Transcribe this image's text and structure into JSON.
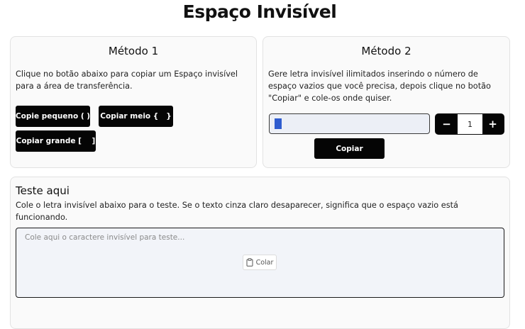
{
  "page": {
    "title": "Espaço Invisível"
  },
  "method1": {
    "title": "Método 1",
    "description": "Clique no botão abaixo para copiar um Espaço invisível para a área de transferência.",
    "buttons": {
      "small": "Copie pequeno ( )",
      "medium": "Copiar meio {   }",
      "large": "Copiar grande [    ]"
    }
  },
  "method2": {
    "title": "Método 2",
    "description": "Gere letra invisível ilimitados inserindo o número de espaço vazios que você precisa, depois clique no botão \"Copiar\" e cole-os onde quiser.",
    "stepper": {
      "minus": "−",
      "value": "1",
      "plus": "+"
    },
    "copy_label": "Copiar"
  },
  "test": {
    "title": "Teste aqui",
    "description": "Cole o letra invisível abaixo para o teste. Se o texto cinza claro desaparecer, significa que o espaço vazio está funcionando.",
    "placeholder": "Cole aqui o caractere invisível para teste...",
    "paste_label": "Colar",
    "paste_icon": "clipboard-icon"
  },
  "colors": {
    "button_bg": "#050505",
    "input_bg": "#eceff6",
    "caret": "#2f5ccf",
    "card_bg": "#fafafa"
  }
}
